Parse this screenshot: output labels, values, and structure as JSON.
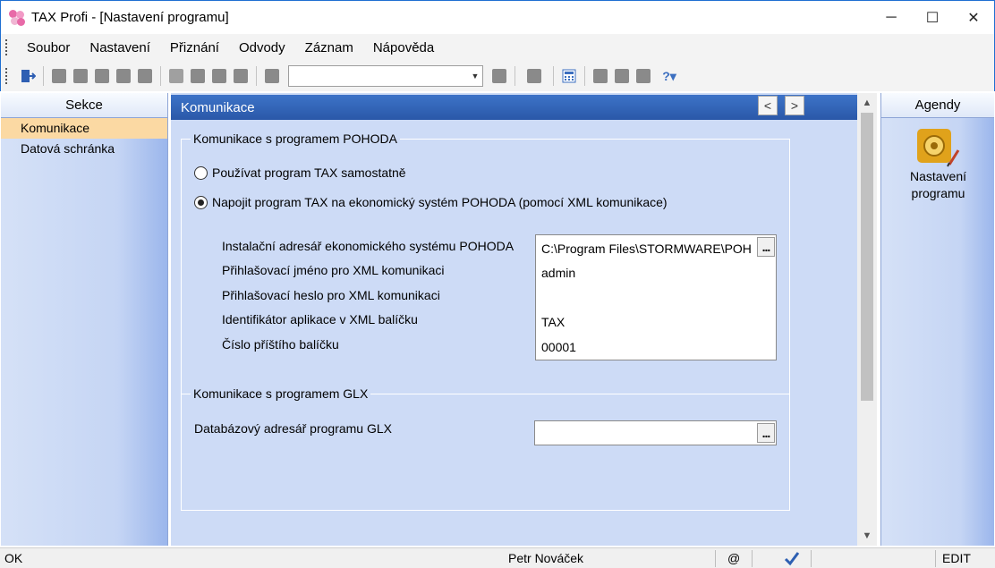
{
  "window": {
    "title": "TAX Profi - [Nastavení programu]",
    "minimize": "─",
    "maximize": "☐",
    "close": "✕"
  },
  "menu": [
    "Soubor",
    "Nastavení",
    "Přiznání",
    "Odvody",
    "Záznam",
    "Nápověda"
  ],
  "toolbar": {
    "combo_value": "",
    "icons": [
      "exit-icon",
      "copy-icon",
      "print-icon",
      "preview-icon",
      "export-icon",
      "paste-icon",
      "new-icon",
      "edit-icon",
      "save-icon",
      "delete-icon",
      "duplicate-icon",
      "filter-icon",
      "folder-icon",
      "calculator-icon",
      "import-icon",
      "info-icon",
      "card-icon",
      "help-icon"
    ]
  },
  "sections": {
    "header": "Sekce",
    "items": [
      {
        "label": "Komunikace",
        "active": true
      },
      {
        "label": "Datová schránka",
        "active": false
      }
    ]
  },
  "main": {
    "header": "Komunikace",
    "pohoda": {
      "group_title": "Komunikace s programem POHODA",
      "radio1": "Používat program TAX samostatně",
      "radio2": "Napojit program TAX na ekonomický systém POHODA (pomocí XML komunikace)",
      "selected": "radio2",
      "fields": [
        {
          "label": "Instalační adresář ekonomického systému POHODA",
          "value": "C:\\Program Files\\STORMWARE\\POH"
        },
        {
          "label": "Přihlašovací jméno pro XML komunikaci",
          "value": "admin"
        },
        {
          "label": "Přihlašovací heslo pro XML komunikaci",
          "value": ""
        },
        {
          "label": "Identifikátor aplikace v XML balíčku",
          "value": "TAX"
        },
        {
          "label": "Číslo příštího balíčku",
          "value": "00001"
        }
      ]
    },
    "glx": {
      "group_title": "Komunikace s programem GLX",
      "field_label": "Databázový adresář programu GLX",
      "field_value": ""
    },
    "browse_label": "..."
  },
  "agendas": {
    "header": "Agendy",
    "item_line1": "Nastavení",
    "item_line2": "programu"
  },
  "status": {
    "state": "OK",
    "user": "Petr Nováček",
    "at": "@",
    "mode": "EDIT"
  }
}
